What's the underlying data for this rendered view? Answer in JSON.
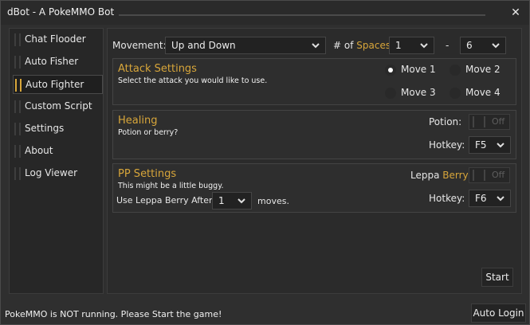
{
  "window": {
    "title": "dBot - A PokeMMO Bot",
    "close_glyph": "✕"
  },
  "sidebar": {
    "items": [
      {
        "label": "Chat Flooder",
        "active": false
      },
      {
        "label": "Auto Fisher",
        "active": false
      },
      {
        "label": "Auto Fighter",
        "active": true
      },
      {
        "label": "Custom Script",
        "active": false
      },
      {
        "label": "Settings",
        "active": false
      },
      {
        "label": "About",
        "active": false
      },
      {
        "label": "Log Viewer",
        "active": false
      }
    ]
  },
  "movement": {
    "label": "Movement:",
    "value": "Up and Down",
    "spaces_prefix": "# of",
    "spaces_word": "Spaces:",
    "from": "1",
    "dash": "-",
    "to": "6"
  },
  "attack": {
    "title": "Attack Settings",
    "desc": "Select the attack you would like to use.",
    "moves": [
      "Move 1",
      "Move 2",
      "Move 3",
      "Move 4"
    ],
    "selected": "Move 1"
  },
  "healing": {
    "title": "Healing",
    "desc": "Potion or berry?",
    "potion_label": "Potion:",
    "potion_state": "Off",
    "hotkey_label": "Hotkey:",
    "hotkey_value": "F5"
  },
  "pp": {
    "title": "PP Settings",
    "desc": "This might be a little buggy.",
    "after_label": "Use Leppa Berry After",
    "after_value": "1",
    "after_suffix": "moves.",
    "leppa_prefix": "Leppa",
    "leppa_word": "Berry:",
    "leppa_state": "Off",
    "hotkey_label": "Hotkey:",
    "hotkey_value": "F6"
  },
  "actions": {
    "start": "Start",
    "auto_login": "Auto Login"
  },
  "status": {
    "text": "PokeMMO is NOT running. Please Start the game!"
  },
  "colors": {
    "accent": "#d8a63a",
    "background": "#2f2f2f"
  }
}
